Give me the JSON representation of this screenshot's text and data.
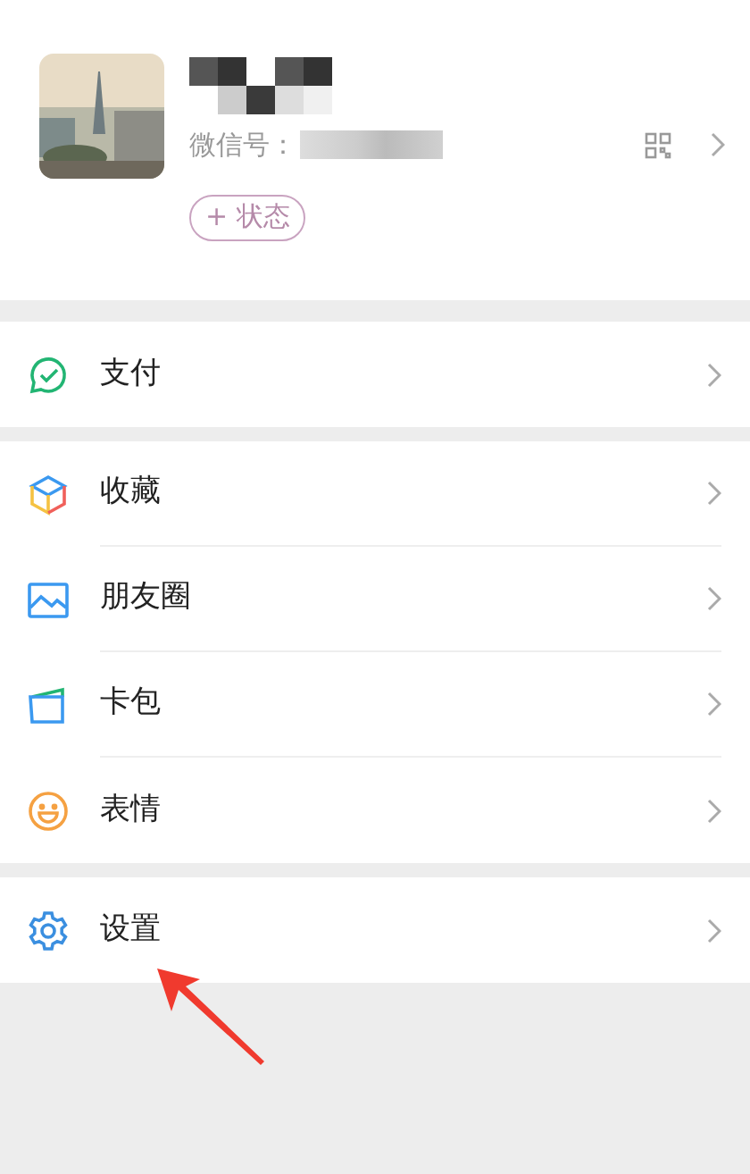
{
  "profile": {
    "id_label": "微信号：",
    "status_button": "+ 状态"
  },
  "groups": [
    {
      "items": [
        {
          "kind": "pay",
          "label": "支付"
        }
      ]
    },
    {
      "items": [
        {
          "kind": "favorites",
          "label": "收藏"
        },
        {
          "kind": "moments",
          "label": "朋友圈"
        },
        {
          "kind": "cards",
          "label": "卡包"
        },
        {
          "kind": "stickers",
          "label": "表情"
        }
      ]
    },
    {
      "items": [
        {
          "kind": "settings",
          "label": "设置"
        }
      ]
    }
  ]
}
